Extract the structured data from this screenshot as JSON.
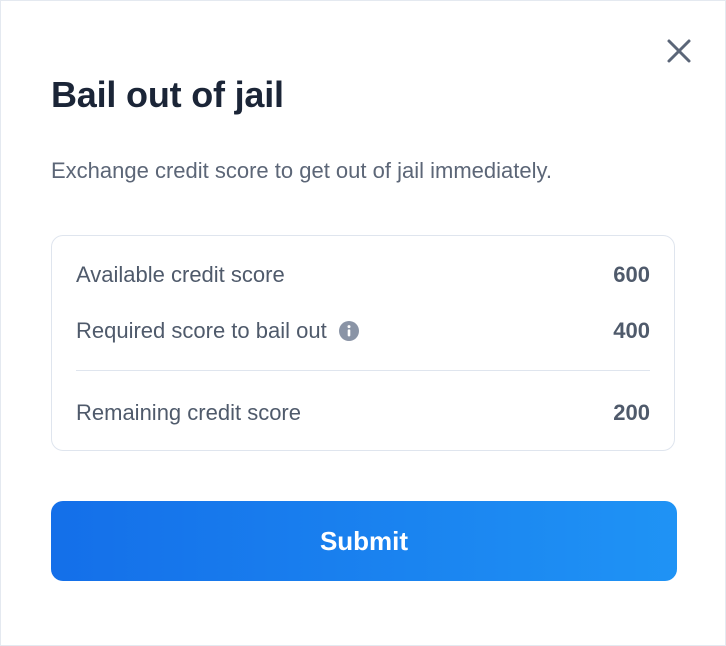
{
  "dialog": {
    "title": "Bail out of jail",
    "subtitle": "Exchange credit score to get out of jail immediately.",
    "close_icon": "close-icon"
  },
  "scores": {
    "available_label": "Available credit score",
    "available_value": "600",
    "required_label": "Required score to bail out",
    "required_value": "400",
    "required_icon": "info-icon",
    "remaining_label": "Remaining credit score",
    "remaining_value": "200"
  },
  "actions": {
    "submit_label": "Submit"
  },
  "colors": {
    "accent_start": "#146fe9",
    "accent_end": "#1f93f5",
    "title": "#1b2537",
    "text": "#4f5a6b",
    "border": "#dfe5ee"
  }
}
